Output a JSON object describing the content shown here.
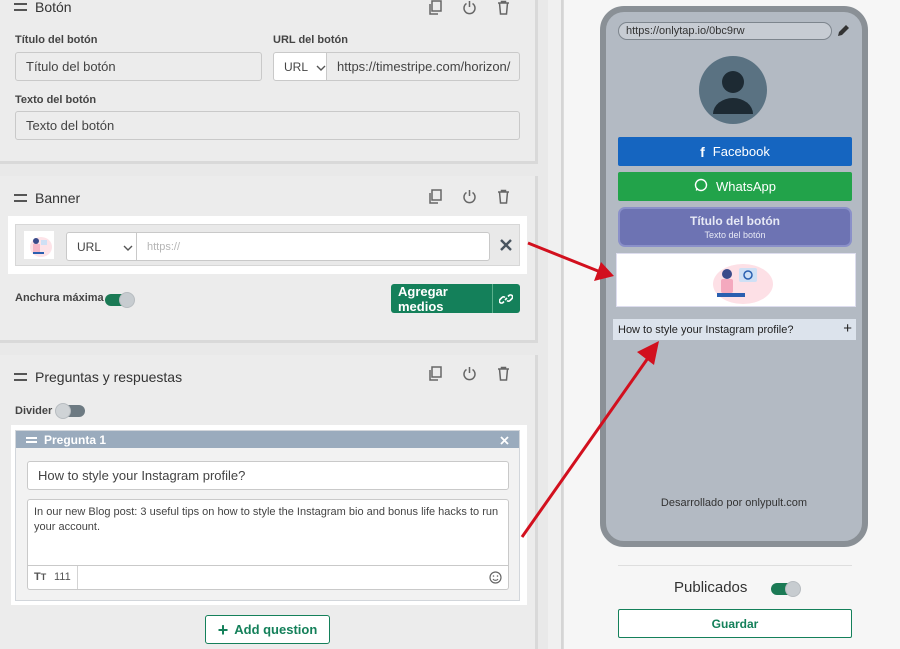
{
  "button_card": {
    "title": "Botón",
    "title_label": "Título del botón",
    "title_value": "Título del botón",
    "url_label": "URL del botón",
    "url_type": "URL",
    "url_value": "https://timestripe.com/horizon/",
    "text_label": "Texto del botón",
    "text_value": "Texto del botón"
  },
  "banner_card": {
    "title": "Banner",
    "url_type": "URL",
    "url_placeholder": "https://",
    "max_width_label": "Anchura máxima",
    "add_media_label": "Agregar medios"
  },
  "faq_card": {
    "title": "Preguntas y respuestas",
    "divider_label": "Divider",
    "question_header": "Pregunta 1",
    "question_value": "How to style your Instagram profile?",
    "answer_value": "In our new Blog post: 3 useful tips on how to style the Instagram bio and bonus life hacks to run your account.",
    "char_count": "111",
    "add_question_label": "Add question"
  },
  "preview": {
    "url": "https://onlytap.io/0bc9rw",
    "facebook_label": "Facebook",
    "whatsapp_label": "WhatsApp",
    "button_title": "Título del botón",
    "button_subtitle": "Texto del botón",
    "faq_question": "How to style your Instagram profile?",
    "footer": "Desarrollado por onlypult.com",
    "published_label": "Publicados",
    "save_label": "Guardar"
  },
  "colors": {
    "facebook": "#1565c0",
    "whatsapp": "#22a34a",
    "accent_green": "#14805a",
    "arrow": "#d2101e"
  }
}
